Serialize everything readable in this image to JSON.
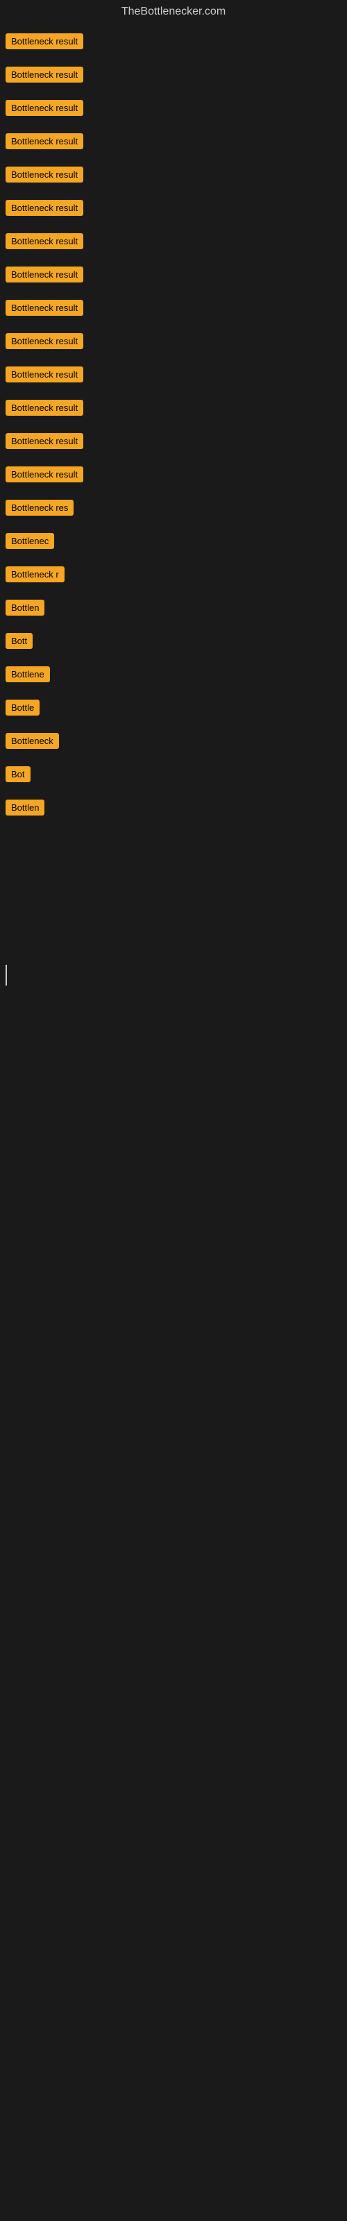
{
  "site": {
    "title": "TheBottlenecker.com"
  },
  "items": [
    {
      "id": 1,
      "label": "Bottleneck result",
      "width": 130
    },
    {
      "id": 2,
      "label": "Bottleneck result",
      "width": 130
    },
    {
      "id": 3,
      "label": "Bottleneck result",
      "width": 130
    },
    {
      "id": 4,
      "label": "Bottleneck result",
      "width": 130
    },
    {
      "id": 5,
      "label": "Bottleneck result",
      "width": 130
    },
    {
      "id": 6,
      "label": "Bottleneck result",
      "width": 130
    },
    {
      "id": 7,
      "label": "Bottleneck result",
      "width": 130
    },
    {
      "id": 8,
      "label": "Bottleneck result",
      "width": 130
    },
    {
      "id": 9,
      "label": "Bottleneck result",
      "width": 130
    },
    {
      "id": 10,
      "label": "Bottleneck result",
      "width": 130
    },
    {
      "id": 11,
      "label": "Bottleneck result",
      "width": 130
    },
    {
      "id": 12,
      "label": "Bottleneck result",
      "width": 130
    },
    {
      "id": 13,
      "label": "Bottleneck result",
      "width": 130
    },
    {
      "id": 14,
      "label": "Bottleneck result",
      "width": 130
    },
    {
      "id": 15,
      "label": "Bottleneck res",
      "width": 110
    },
    {
      "id": 16,
      "label": "Bottlenec",
      "width": 80
    },
    {
      "id": 17,
      "label": "Bottleneck r",
      "width": 90
    },
    {
      "id": 18,
      "label": "Bottlen",
      "width": 72
    },
    {
      "id": 19,
      "label": "Bott",
      "width": 44
    },
    {
      "id": 20,
      "label": "Bottlene",
      "width": 74
    },
    {
      "id": 21,
      "label": "Bottle",
      "width": 58
    },
    {
      "id": 22,
      "label": "Bottleneck",
      "width": 84
    },
    {
      "id": 23,
      "label": "Bot",
      "width": 36
    },
    {
      "id": 24,
      "label": "Bottlen",
      "width": 72
    }
  ],
  "colors": {
    "badge_bg": "#f5a623",
    "badge_text": "#000000",
    "site_title": "#cccccc",
    "body_bg": "#1a1a1a"
  }
}
